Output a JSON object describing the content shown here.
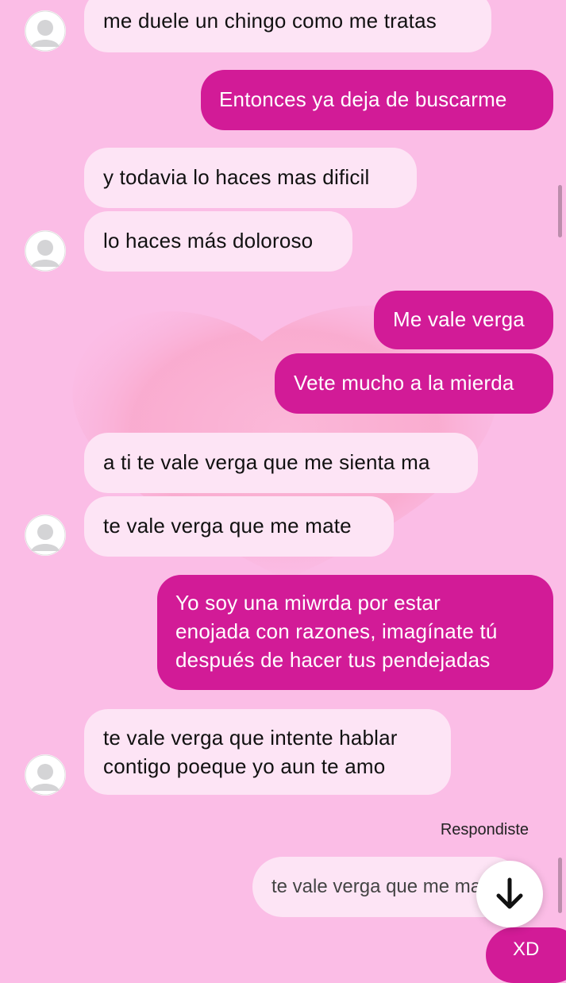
{
  "messages": [
    {
      "id": 1,
      "side": "in",
      "text": "me duele un chingo como me tratas"
    },
    {
      "id": 2,
      "side": "out",
      "text": "Entonces ya deja de buscarme"
    },
    {
      "id": 3,
      "side": "in",
      "text": "y todavia lo haces mas dificil"
    },
    {
      "id": 4,
      "side": "in",
      "text": "lo haces más doloroso"
    },
    {
      "id": 5,
      "side": "out",
      "text": "Me vale verga"
    },
    {
      "id": 6,
      "side": "out",
      "text": "Vete mucho a la mierda"
    },
    {
      "id": 7,
      "side": "in",
      "text": "a ti te vale verga que me sienta ma"
    },
    {
      "id": 8,
      "side": "in",
      "text": "te vale verga que me mate"
    },
    {
      "id": 9,
      "side": "out",
      "lines": [
        "Yo soy una miwrda por estar",
        "enojada con razones, imagínate tú",
        "después de hacer tus pendejadas"
      ]
    },
    {
      "id": 10,
      "side": "in",
      "lines": [
        "te vale verga que intente hablar",
        "contigo poeque yo aun te amo"
      ]
    }
  ],
  "reply": {
    "label": "Respondiste",
    "quoted_text": "te vale verga que me mate"
  },
  "bottom_bubble_text": "XD",
  "icons": {
    "avatar": "default-avatar-icon",
    "scroll_down": "arrow-down-icon"
  },
  "colors": {
    "background": "#fbbde6",
    "incoming_bubble": "#fde4f5",
    "outgoing_bubble": "#d21b97"
  }
}
